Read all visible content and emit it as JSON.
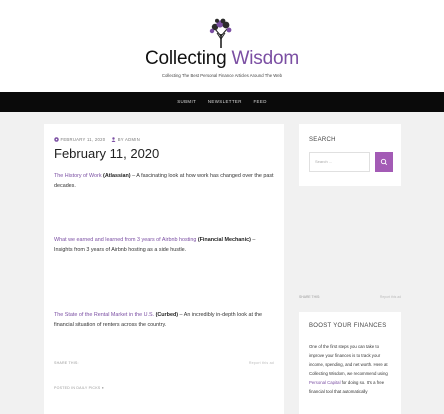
{
  "site": {
    "title_part1": "Collecting",
    "title_part2": "Wisdom",
    "tagline": "Collecting The Best Personal Finance Articles Around The Web"
  },
  "nav": {
    "items": [
      "SUBMIT",
      "NEWSLETTER",
      "FEED"
    ]
  },
  "post": {
    "date": "FEBRUARY 11, 2020",
    "author": "BY ADMIN",
    "title": "February 11, 2020",
    "items": [
      {
        "link": "The History of Work",
        "source": "(Atlassian)",
        "text": " – A fascinating look at how work has changed over the past decades."
      },
      {
        "link": "What we earned and learned from 3 years of Airbnb hosting",
        "source": "(Financial Mechanic)",
        "text": " – Insights from 3 years of Airbnb hosting as a side hustle."
      },
      {
        "link": "The State of the Rental Market in the U.S.",
        "source": "(Curbed)",
        "text": " – An incredibly in-depth look at the financial situation of renters across the country."
      }
    ],
    "share_left": "SHARE THIS:",
    "share_right": "Report this ad",
    "posted_in": "POSTED IN DAILY PICKS ●"
  },
  "sidebar": {
    "search_title": "SEARCH",
    "search_placeholder": "Search ...",
    "share_left": "SHARE THIS:",
    "share_right": "Report this ad",
    "boost_title": "BOOST YOUR FINANCES",
    "boost_text_before": "One of the first steps you can take to improve your finances is to track your income, spending, and net worth. Here at Collecting Wisdom, we recommend using ",
    "boost_link": "Personal Capital",
    "boost_text_after": " for doing so. It's a free financial tool that automatically"
  },
  "colors": {
    "accent": "#7b4fa3",
    "button": "#a35bb5",
    "navbar": "#0a0a0a",
    "background": "#f1f1f1"
  }
}
